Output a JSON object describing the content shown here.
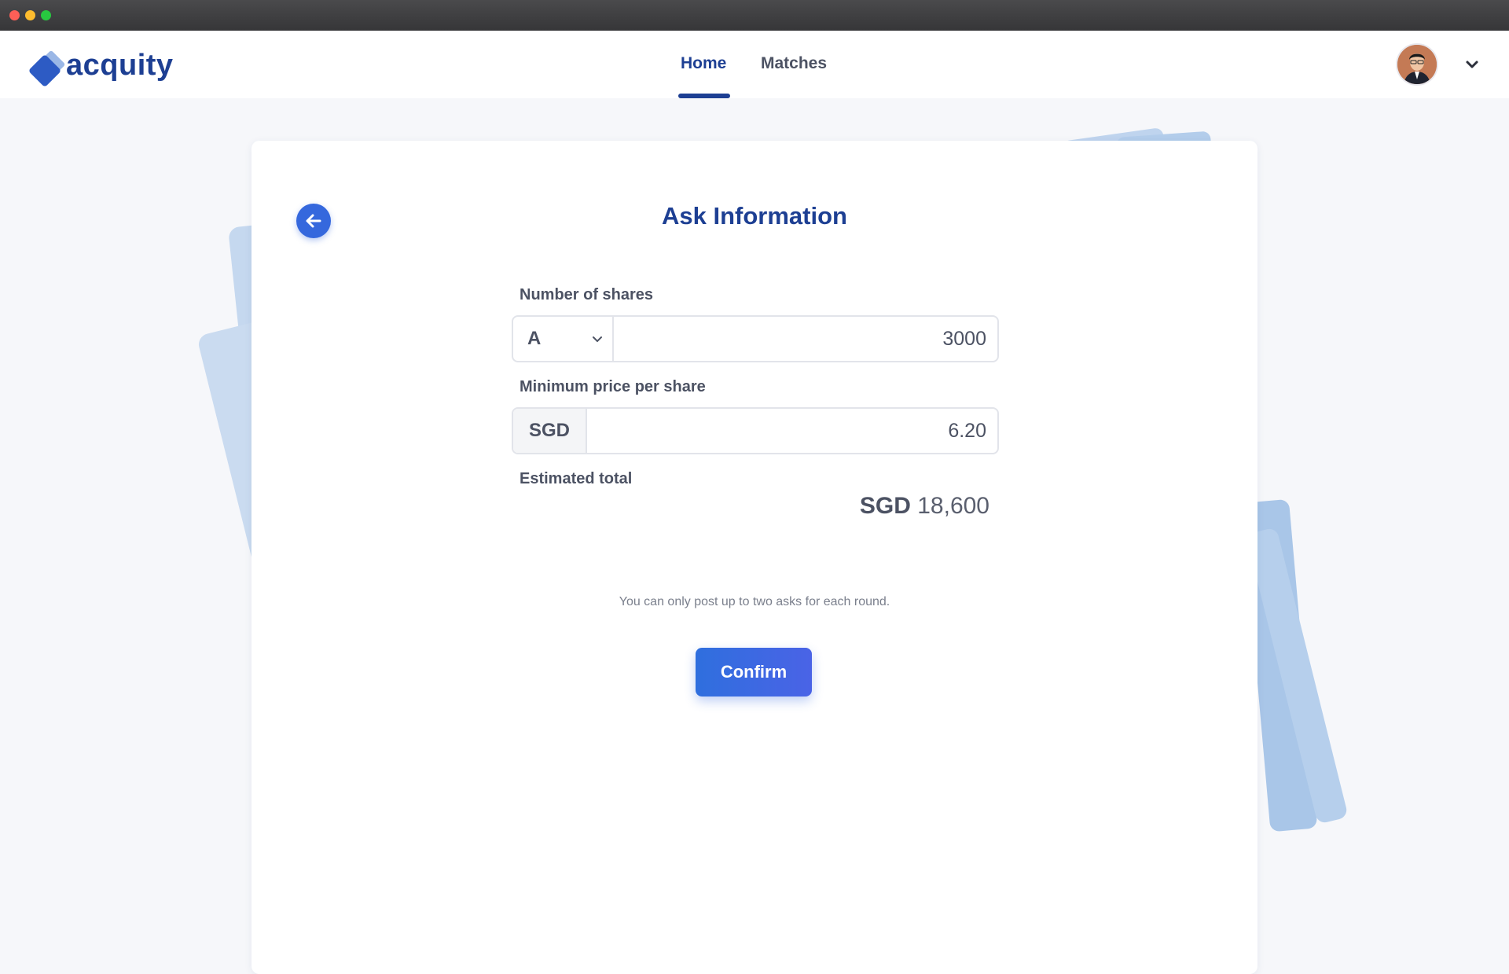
{
  "window": {
    "buttons": [
      "close",
      "minimize",
      "maximize"
    ]
  },
  "brand": {
    "name": "acquity",
    "color": "#1d3f93"
  },
  "nav": {
    "items": [
      {
        "label": "Home",
        "active": true
      },
      {
        "label": "Matches",
        "active": false
      }
    ]
  },
  "user": {
    "avatar_icon": "user-avatar",
    "menu_icon": "chevron-down-icon"
  },
  "form": {
    "title": "Ask Information",
    "shares": {
      "label": "Number of shares",
      "share_class": "A",
      "value": "3000"
    },
    "price": {
      "label": "Minimum price per share",
      "currency": "SGD",
      "value": "6.20"
    },
    "total": {
      "label": "Estimated total",
      "currency": "SGD",
      "amount": "18,600"
    },
    "note": "You can only post up to two asks for each round.",
    "confirm_label": "Confirm"
  },
  "colors": {
    "primary": "#3568dd",
    "brand_navy": "#1d3f93",
    "text": "#4c5263",
    "background": "#f6f7fa",
    "decor_cards": "#a9c6e8"
  }
}
